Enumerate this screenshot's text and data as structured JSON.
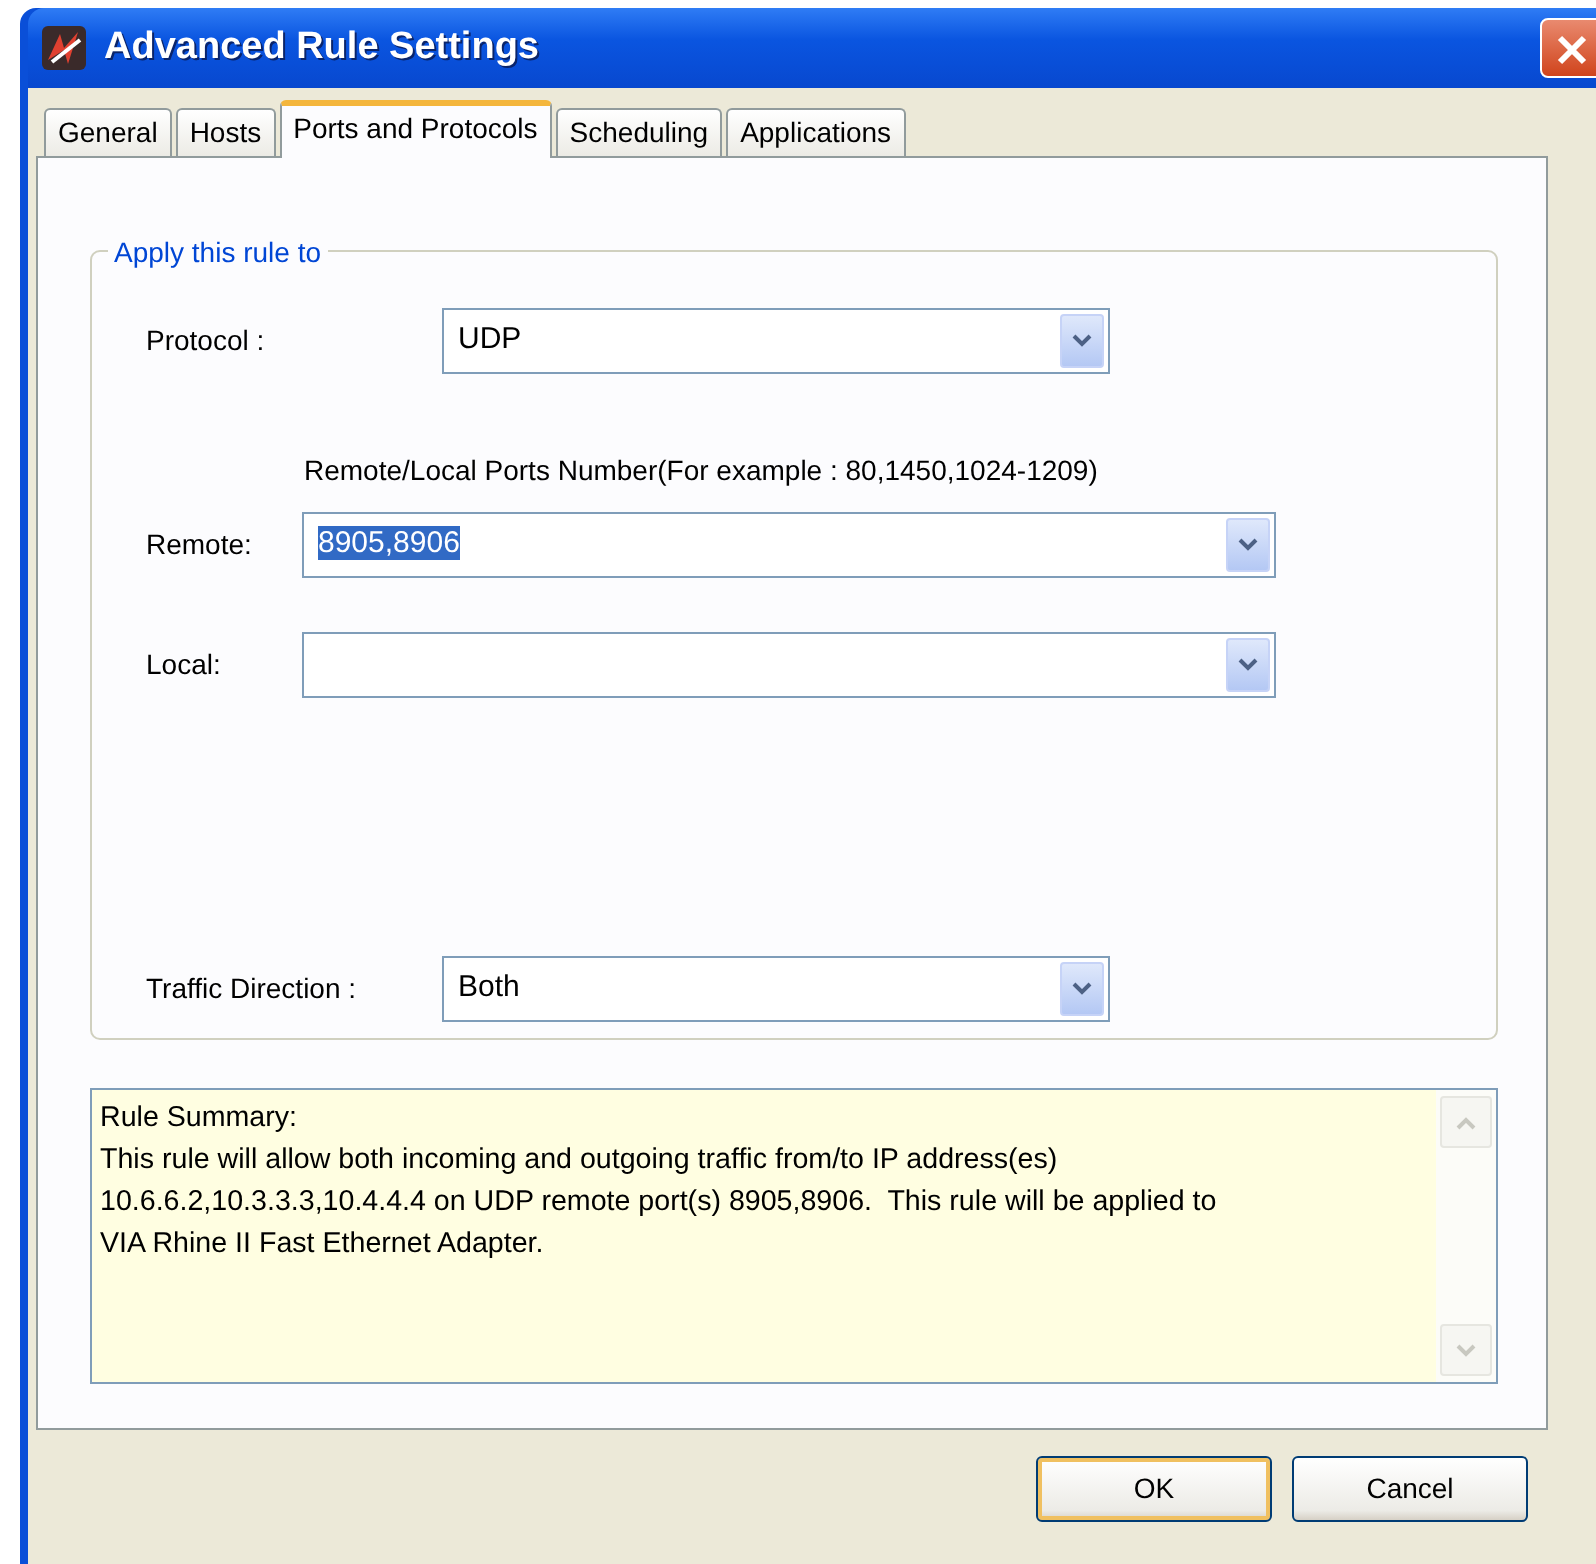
{
  "window": {
    "title": "Advanced Rule Settings"
  },
  "tabs": [
    {
      "label": "General",
      "selected": false
    },
    {
      "label": "Hosts",
      "selected": false
    },
    {
      "label": "Ports and Protocols",
      "selected": true
    },
    {
      "label": "Scheduling",
      "selected": false
    },
    {
      "label": "Applications",
      "selected": false
    }
  ],
  "group": {
    "title": "Apply this rule to",
    "protocol": {
      "label": "Protocol :",
      "value": "UDP"
    },
    "ports_hint": "Remote/Local Ports Number(For example : 80,1450,1024-1209)",
    "remote": {
      "label": "Remote:",
      "value": "8905,8906",
      "selected": true
    },
    "local": {
      "label": "Local:"
    },
    "direction": {
      "label": "Traffic Direction :",
      "value": "Both"
    }
  },
  "summary": {
    "title": "Rule Summary:",
    "lines": [
      "This rule will allow both incoming and outgoing traffic from/to IP address(es)",
      "10.6.6.2,10.3.3.3,10.4.4.4 on UDP remote port(s) 8905,8906.  This rule will be applied to",
      "VIA Rhine II Fast Ethernet Adapter."
    ]
  },
  "buttons": [
    {
      "label": "OK",
      "default": true
    },
    {
      "label": "Cancel",
      "default": false
    }
  ]
}
